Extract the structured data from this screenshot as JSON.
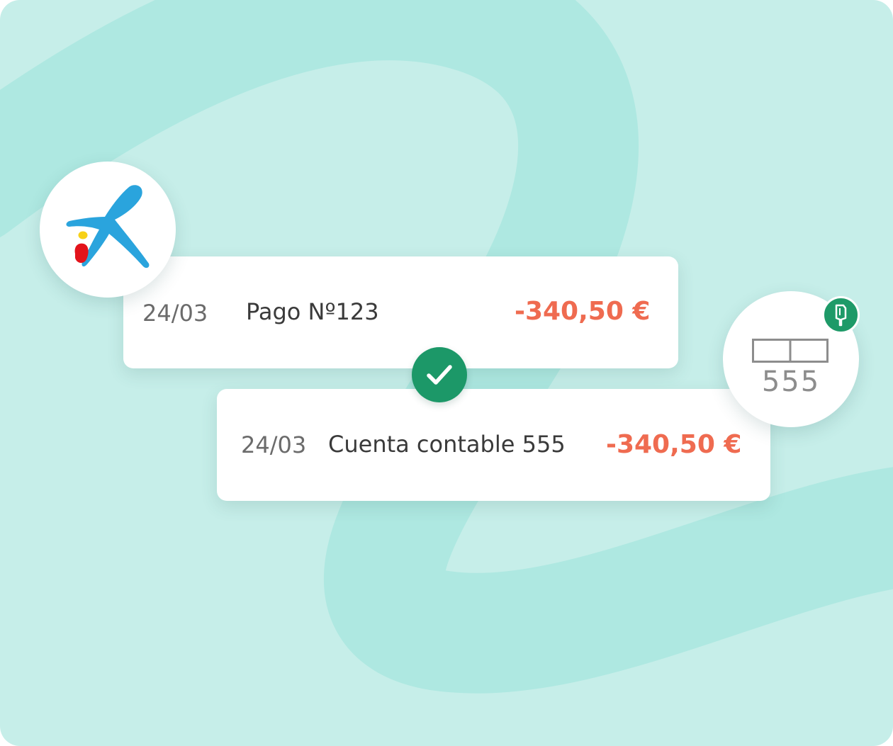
{
  "bank_movement": {
    "date": "24/03",
    "concept": "Pago Nº123",
    "amount": "-340,50 €"
  },
  "ledger_entry": {
    "date": "24/03",
    "concept": "Cuenta contable 555",
    "amount": "-340,50 €"
  },
  "account_badge": {
    "number": "555"
  },
  "icons": {
    "bank_logo": "caixabank-star-logo",
    "match": "check-icon",
    "tag": "tag-icon"
  },
  "colors": {
    "background": "#c6eee9",
    "swoosh": "#aee8e1",
    "amount": "#ef6b50",
    "accent_green": "#1e9a68",
    "logo_blue": "#2aa4dd",
    "logo_red": "#e3131b",
    "logo_yellow": "#f7d117"
  }
}
